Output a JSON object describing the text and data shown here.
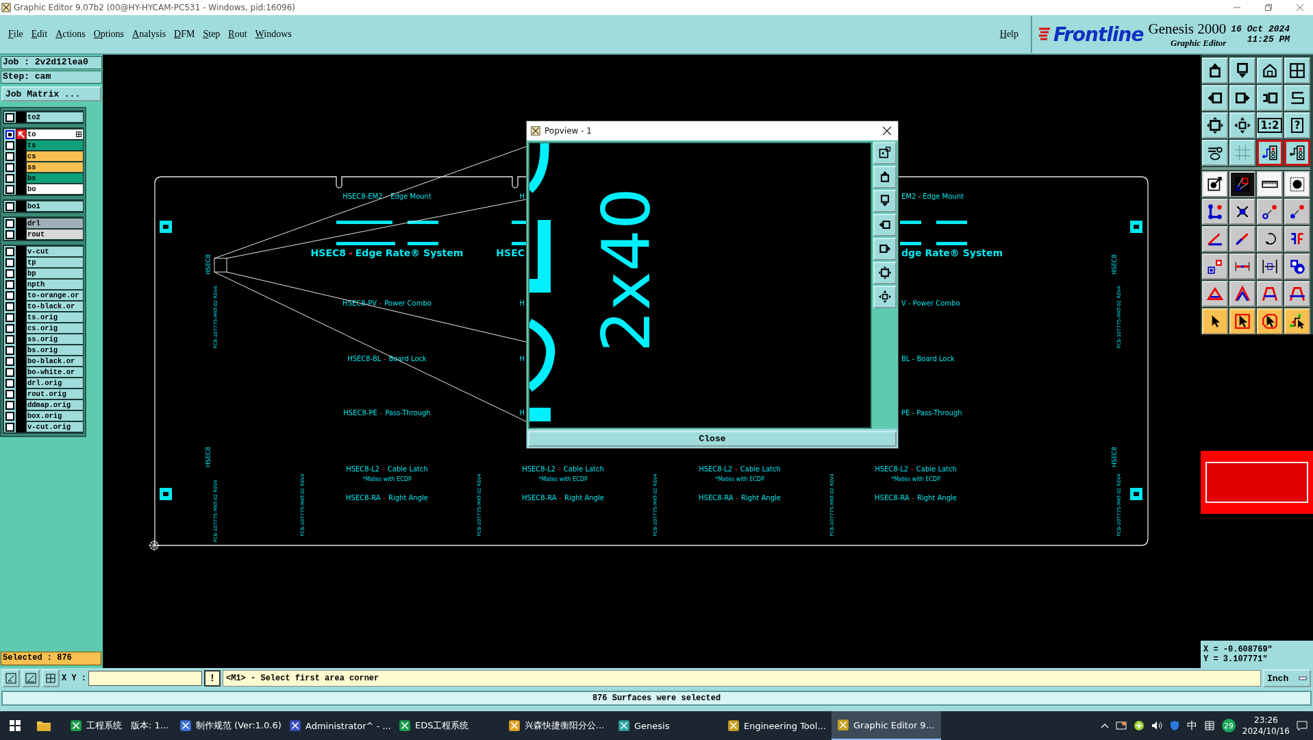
{
  "title_bar": {
    "title": "Graphic Editor 9.07b2 (00@HY-HYCAM-PC531 - Windows, pid:16096)"
  },
  "menu": [
    "File",
    "Edit",
    "Actions",
    "Options",
    "Analysis",
    "DFM",
    "Step",
    "Rout",
    "Windows"
  ],
  "help": "Help",
  "brand": {
    "logo": "Frontline",
    "product": "Genesis 2000",
    "subtitle": "Graphic Editor",
    "date": "16 Oct 2024",
    "time": "11:25 PM"
  },
  "job": {
    "job": "Job : 2v2d12lea0",
    "step": "Step: cam",
    "matrix_button": "Job Matrix ..."
  },
  "layer_groups": [
    [
      {
        "name": "to2",
        "color": "#a0dcdc",
        "work": false
      }
    ],
    [
      {
        "name": "to",
        "color": "#ffffff",
        "work": true
      },
      {
        "name": "ts",
        "color": "#10a078",
        "work": false
      },
      {
        "name": "cs",
        "color": "#f8c050",
        "work": false
      },
      {
        "name": "ss",
        "color": "#f8c050",
        "work": false
      },
      {
        "name": "bs",
        "color": "#10a078",
        "work": false
      },
      {
        "name": "bo",
        "color": "#ffffff",
        "work": false
      }
    ],
    [
      {
        "name": "bo1",
        "color": "#a0dcdc",
        "work": false
      }
    ],
    [
      {
        "name": "drl",
        "color": "#a0b0b8",
        "work": false
      },
      {
        "name": "rout",
        "color": "#d8d8d8",
        "work": false
      }
    ],
    [
      {
        "name": "v-cut",
        "color": "#a0dcdc",
        "work": false
      },
      {
        "name": "tp",
        "color": "#a0dcdc",
        "work": false
      },
      {
        "name": "bp",
        "color": "#a0dcdc",
        "work": false
      },
      {
        "name": "npth",
        "color": "#a0dcdc",
        "work": false
      },
      {
        "name": "to-orange.or",
        "color": "#a0dcdc",
        "work": false
      },
      {
        "name": "to-black.or",
        "color": "#a0dcdc",
        "work": false
      },
      {
        "name": "ts.orig",
        "color": "#a0dcdc",
        "work": false
      },
      {
        "name": "cs.orig",
        "color": "#a0dcdc",
        "work": false
      },
      {
        "name": "ss.orig",
        "color": "#a0dcdc",
        "work": false
      },
      {
        "name": "bs.orig",
        "color": "#a0dcdc",
        "work": false
      },
      {
        "name": "bo-black.or",
        "color": "#a0dcdc",
        "work": false
      },
      {
        "name": "bo-white.or",
        "color": "#a0dcdc",
        "work": false
      },
      {
        "name": "drl.orig",
        "color": "#a0dcdc",
        "work": false
      },
      {
        "name": "rout.orig",
        "color": "#a0dcdc",
        "work": false
      },
      {
        "name": "ddmap.orig",
        "color": "#a0dcdc",
        "work": false
      },
      {
        "name": "box.orig",
        "color": "#a0dcdc",
        "work": false
      },
      {
        "name": "v-cut.orig",
        "color": "#a0dcdc",
        "work": false
      }
    ]
  ],
  "selected_count": "Selected : 876",
  "board": {
    "columns": [
      {
        "upper": [
          {
            "part": "HSEC8-EM2",
            "sep": "-",
            "desc": "Edge Mount"
          },
          {
            "part": "HSEC8",
            "sep": "-",
            "desc": "Edge Rate® System"
          },
          {
            "part": "HSEC8-PV",
            "sep": "-",
            "desc": "Power Combo"
          },
          {
            "part": "HSEC8-BL",
            "sep": "-",
            "desc": "Board Lock"
          },
          {
            "part": "HSEC8-PE",
            "sep": "-",
            "desc": "Pass-Through"
          }
        ],
        "lower": [
          {
            "part": "HSEC8-L2",
            "sep": "-",
            "desc": "Cable Latch"
          },
          {
            "text": "*Mates with ECDP"
          },
          {
            "part": "HSEC8-RA",
            "sep": "-",
            "desc": "Right Angle"
          }
        ]
      },
      {
        "upper": [
          {
            "text": "H"
          },
          {
            "text": "HSEC"
          },
          {
            "text": "H"
          },
          {
            "text": "H"
          },
          {
            "text": "H"
          }
        ],
        "lower": [
          {
            "part": "HSEC8-L2",
            "sep": "-",
            "desc": "Cable Latch"
          },
          {
            "text": "*Mates with ECDP"
          },
          {
            "part": "HSEC8-RA",
            "sep": "-",
            "desc": "Right Angle"
          }
        ]
      },
      {
        "lower": [
          {
            "part": "HSEC8-L2",
            "sep": "-",
            "desc": "Cable Latch"
          },
          {
            "text": "*Mates with ECDP"
          },
          {
            "part": "HSEC8-RA",
            "sep": "-",
            "desc": "Right Angle"
          }
        ]
      },
      {
        "upper": [
          {
            "text": "EM2 - Edge Mount"
          },
          {
            "text": "dge Rate® System"
          },
          {
            "text": "V - Power Combo"
          },
          {
            "text": "BL - Board Lock"
          },
          {
            "text": "PE - Pass-Through"
          }
        ],
        "lower": [
          {
            "part": "HSEC8-L2",
            "sep": "-",
            "desc": "Cable Latch"
          },
          {
            "text": "*Mates with ECDP"
          },
          {
            "part": "HSEC8-RA",
            "sep": "-",
            "desc": "Right Angle"
          }
        ]
      }
    ],
    "side_labels": [
      "HSEC8",
      "PCB-107775-MKT-02 REV4",
      "HSEC8",
      "PCB-107775-MKT-02 REV4",
      "PCB-107775-MKT-02 REV4",
      "PCB-107775-MKT-02 REV4",
      "PCB-107775-MKT-02 REV4",
      "PCB-107775-MKT-02 REV4",
      "PCB-107775-MKT-02 REV4",
      "PCB-107775-MKT-02 REV4",
      "HSEC8",
      "HSEC8"
    ]
  },
  "popview": {
    "title": "Popview - 1",
    "view_text": "2x40",
    "close_button": "Close"
  },
  "tool_buttons": [
    {
      "kind": "teal"
    },
    {
      "kind": "teal"
    },
    {
      "kind": "teal"
    },
    {
      "kind": "teal"
    },
    {
      "kind": "teal"
    },
    {
      "kind": "teal"
    },
    {
      "kind": "teal"
    },
    {
      "kind": "teal"
    },
    {
      "kind": "teal"
    },
    {
      "kind": "teal"
    },
    {
      "kind": "teal",
      "label": "1:2"
    },
    {
      "kind": "teal",
      "label": "?"
    },
    {
      "kind": "teal"
    },
    {
      "kind": "teal"
    },
    {
      "kind": "teal-red"
    },
    {
      "kind": "teal-red"
    },
    {
      "kind": "white"
    },
    {
      "kind": "dark"
    },
    {
      "kind": "white"
    },
    {
      "kind": "white"
    },
    {
      "kind": "gray"
    },
    {
      "kind": "gray"
    },
    {
      "kind": "gray"
    },
    {
      "kind": "gray"
    },
    {
      "kind": "gray"
    },
    {
      "kind": "gray"
    },
    {
      "kind": "gray"
    },
    {
      "kind": "gray"
    },
    {
      "kind": "gray"
    },
    {
      "kind": "gray"
    },
    {
      "kind": "gray"
    },
    {
      "kind": "gray"
    },
    {
      "kind": "gray"
    },
    {
      "kind": "gray"
    },
    {
      "kind": "gray"
    },
    {
      "kind": "gray"
    },
    {
      "kind": "orange"
    },
    {
      "kind": "orange"
    },
    {
      "kind": "orange"
    },
    {
      "kind": "orange"
    }
  ],
  "coordinates": {
    "x": "X = -0.608769\"",
    "y": "Y = 3.107771\""
  },
  "command_bar": {
    "xy_label": "X Y :",
    "bang_button": "!",
    "prompt": "<M1> - Select first area corner",
    "units": "Inch"
  },
  "status": "876 Surfaces were selected",
  "taskbar": {
    "apps": [
      {
        "label": "工程系统　版本: 1...",
        "selected": false
      },
      {
        "label": "制作规范 (Ver:1.0.6)",
        "selected": false
      },
      {
        "label": "Administrator^ - ...",
        "selected": false
      },
      {
        "label": "EDS工程系统",
        "selected": false
      },
      {
        "label": "兴森快捷衡阳分公...",
        "selected": false
      },
      {
        "label": "Genesis",
        "selected": false
      },
      {
        "label": "Engineering Tool...",
        "selected": false
      },
      {
        "label": "Graphic Editor 9...",
        "selected": true
      }
    ],
    "ime": "中",
    "badge": "29",
    "time": "23:26",
    "date": "2024/10/16"
  }
}
